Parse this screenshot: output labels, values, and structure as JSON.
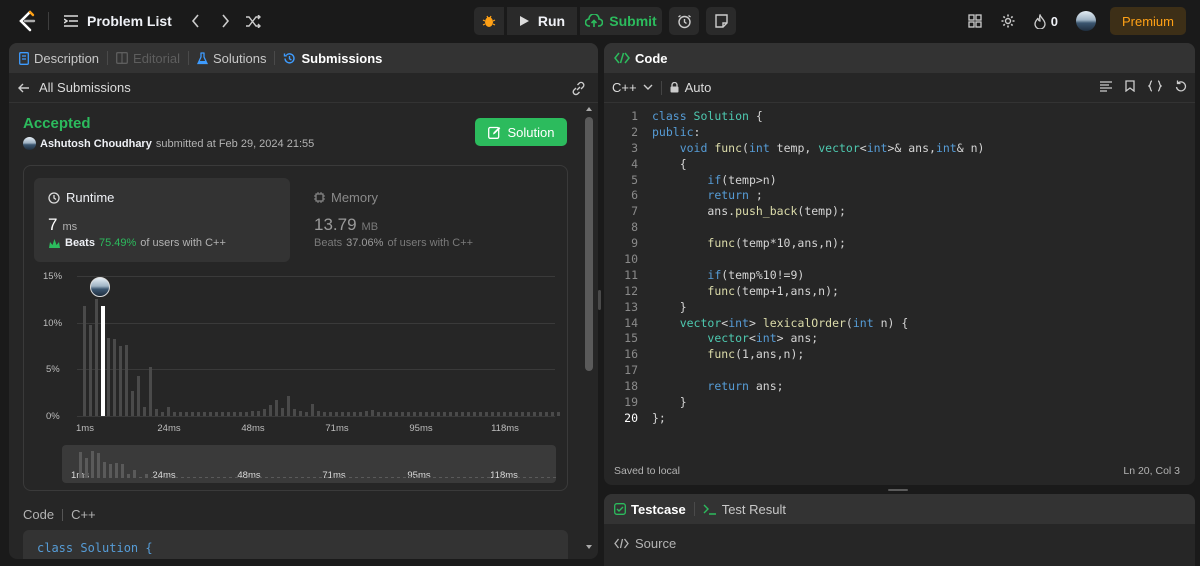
{
  "topbar": {
    "title": "Problem List",
    "run_label": "Run",
    "submit_label": "Submit",
    "streak_count": "0",
    "premium_label": "Premium"
  },
  "left_panel": {
    "tabs": [
      "Description",
      "Editorial",
      "Solutions",
      "Submissions"
    ],
    "back_label": "All Submissions",
    "status": "Accepted",
    "user": "Ashutosh Choudhary",
    "submitted_text": "submitted at Feb 29, 2024 21:55",
    "solution_button": "Solution",
    "runtime": {
      "label": "Runtime",
      "value": "7",
      "unit": "ms",
      "beats_label": "Beats",
      "beats_pct": "75.49%",
      "beats_suffix": "of users with C++"
    },
    "memory": {
      "label": "Memory",
      "value": "13.79",
      "unit": "MB",
      "beats_label": "Beats",
      "beats_pct": "37.06%",
      "beats_suffix": "of users with C++"
    },
    "code_label": "Code",
    "code_lang": "C++",
    "code_preview": "class Solution {"
  },
  "chart_data": {
    "type": "bar",
    "y_ticks": [
      "15%",
      "10%",
      "5%",
      "0%"
    ],
    "ylim": [
      0,
      15
    ],
    "x_ticks": [
      "1ms",
      "24ms",
      "48ms",
      "71ms",
      "95ms",
      "118ms"
    ],
    "values": [
      11.8,
      9.8,
      12.5,
      11.8,
      8.4,
      8.2,
      7.5,
      7.6,
      2.7,
      4.3,
      1.0,
      5.2,
      0.8,
      0.4,
      1.0,
      0.4,
      0.4,
      0.4,
      0.4,
      0.4,
      0.4,
      0.4,
      0.4,
      0.4,
      0.4,
      0.4,
      0.4,
      0.4,
      0.5,
      0.5,
      0.8,
      1.2,
      1.7,
      0.9,
      2.1,
      0.7,
      0.5,
      0.4,
      1.3,
      0.5,
      0.4,
      0.4,
      0.4,
      0.4,
      0.4,
      0.4,
      0.4,
      0.5,
      0.6,
      0.4,
      0.4,
      0.4,
      0.4,
      0.4,
      0.4,
      0.4,
      0.4,
      0.4,
      0.4,
      0.4,
      0.4,
      0.4,
      0.4,
      0.4,
      0.4,
      0.4,
      0.4,
      0.4,
      0.4,
      0.4,
      0.4,
      0.4,
      0.4,
      0.4,
      0.4,
      0.4,
      0.4,
      0.4,
      0.4,
      0.4
    ],
    "highlight_index": 3,
    "minimap_values": [
      10.5,
      8.0,
      11.0,
      10.0,
      6.5,
      5.8,
      6.1,
      5.5,
      1.8,
      3.3,
      0.5,
      1.6,
      0.5,
      0.5,
      0.5,
      0.5,
      0.5,
      0.5,
      0.5,
      0.5,
      0.5,
      0.5,
      0.5,
      0.5,
      0.5,
      0.5,
      0.5,
      0.5,
      0.5,
      0.5,
      0.5,
      0.5,
      0.5,
      0.5,
      0.5,
      0.5,
      0.5,
      0.5,
      0.5,
      0.5,
      0.5,
      0.5,
      0.5,
      0.5,
      0.5,
      0.5,
      0.5,
      0.5,
      0.5,
      0.5,
      0.5,
      0.5,
      0.5,
      0.5,
      0.5,
      0.5,
      0.5,
      0.5,
      0.5,
      0.5,
      0.5,
      0.5,
      0.5,
      0.5,
      0.5,
      0.5,
      0.5,
      0.5,
      0.5,
      0.5,
      0.5,
      0.5,
      0.5,
      0.5,
      0.5,
      0.5,
      0.5,
      0.5,
      0.5,
      0.5
    ]
  },
  "right_panel": {
    "title": "Code",
    "language": "C++",
    "mode": "Auto",
    "code_lines": [
      [
        [
          "kw",
          "class "
        ],
        [
          "ty",
          "Solution"
        ],
        [
          "pl",
          " {"
        ]
      ],
      [
        [
          "kw",
          "public"
        ],
        [
          "pl",
          ":"
        ]
      ],
      [
        [
          "pl",
          "    "
        ],
        [
          "kw",
          "void "
        ],
        [
          "fn",
          "func"
        ],
        [
          "pl",
          "("
        ],
        [
          "kw",
          "int "
        ],
        [
          "pl",
          "temp, "
        ],
        [
          "ty",
          "vector"
        ],
        [
          "pl",
          "<"
        ],
        [
          "kw",
          "int"
        ],
        [
          "pl",
          ">& ans,"
        ],
        [
          "kw",
          "int"
        ],
        [
          "pl",
          "& n)"
        ]
      ],
      [
        [
          "pl",
          "    {"
        ]
      ],
      [
        [
          "pl",
          "        "
        ],
        [
          "kw",
          "if"
        ],
        [
          "pl",
          "(temp>n)"
        ]
      ],
      [
        [
          "pl",
          "        "
        ],
        [
          "kw",
          "return"
        ],
        [
          "pl",
          " ;"
        ]
      ],
      [
        [
          "pl",
          "        ans."
        ],
        [
          "fn",
          "push_back"
        ],
        [
          "pl",
          "(temp);"
        ]
      ],
      [
        [
          "pl",
          ""
        ]
      ],
      [
        [
          "pl",
          "        "
        ],
        [
          "fn",
          "func"
        ],
        [
          "pl",
          "(temp*10,ans,n);"
        ]
      ],
      [
        [
          "pl",
          ""
        ]
      ],
      [
        [
          "pl",
          "        "
        ],
        [
          "kw",
          "if"
        ],
        [
          "pl",
          "(temp%10!=9)"
        ]
      ],
      [
        [
          "pl",
          "        "
        ],
        [
          "fn",
          "func"
        ],
        [
          "pl",
          "(temp+1,ans,n);"
        ]
      ],
      [
        [
          "pl",
          "    }"
        ]
      ],
      [
        [
          "pl",
          "    "
        ],
        [
          "ty",
          "vector"
        ],
        [
          "pl",
          "<"
        ],
        [
          "kw",
          "int"
        ],
        [
          "pl",
          "> "
        ],
        [
          "fn",
          "lexicalOrder"
        ],
        [
          "pl",
          "("
        ],
        [
          "kw",
          "int"
        ],
        [
          "pl",
          " n) {"
        ]
      ],
      [
        [
          "pl",
          "        "
        ],
        [
          "ty",
          "vector"
        ],
        [
          "pl",
          "<"
        ],
        [
          "kw",
          "int"
        ],
        [
          "pl",
          "> ans;"
        ]
      ],
      [
        [
          "pl",
          "        "
        ],
        [
          "fn",
          "func"
        ],
        [
          "pl",
          "(1,ans,n);"
        ]
      ],
      [
        [
          "pl",
          ""
        ]
      ],
      [
        [
          "pl",
          "        "
        ],
        [
          "kw",
          "return"
        ],
        [
          "pl",
          " ans;"
        ]
      ],
      [
        [
          "pl",
          "    }"
        ]
      ],
      [
        [
          "pl",
          "};"
        ]
      ]
    ],
    "saved_text": "Saved to local",
    "cursor_pos": "Ln 20, Col 3"
  },
  "bottom_panel": {
    "tab_testcase": "Testcase",
    "tab_result": "Test Result",
    "source_label": "Source"
  },
  "colors": {
    "accepted": "#2cbb5d",
    "run_submit_green": "#2cbb5d",
    "premium": "#ffa116",
    "beats_runtime": "#2cbb5d"
  }
}
